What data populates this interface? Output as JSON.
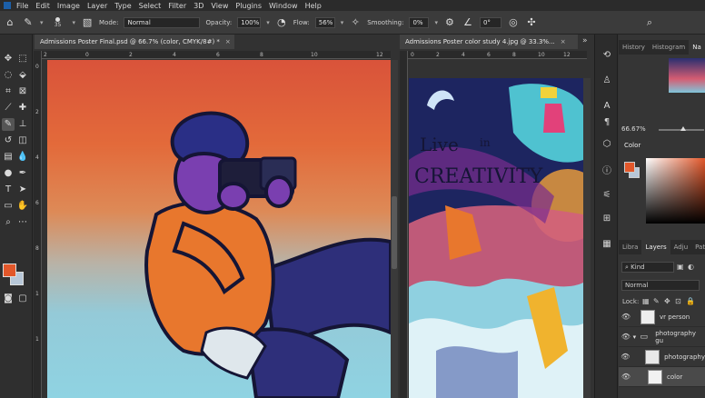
{
  "menu": {
    "items": [
      "File",
      "Edit",
      "Image",
      "Layer",
      "Type",
      "Select",
      "Filter",
      "3D",
      "View",
      "Plugins",
      "Window",
      "Help"
    ]
  },
  "options_bar": {
    "brush_size": "35",
    "mode_label": "Mode:",
    "mode_value": "Normal",
    "opacity_label": "Opacity:",
    "opacity_value": "100%",
    "flow_label": "Flow:",
    "flow_value": "56%",
    "smoothing_label": "Smoothing:",
    "smoothing_value": "0%",
    "angle_value": "0°"
  },
  "documents": {
    "left_tab": "Admissions Poster Final.psd @ 66.7% (color, CMYK/8#) *",
    "right_tab": "Admissions Poster color study 4.jpg @ 33.3%..."
  },
  "rulers": {
    "left_h_ticks": [
      "2",
      "0",
      "2",
      "4",
      "6",
      "8",
      "10",
      "12"
    ],
    "left_v_ticks": [
      "0",
      "2",
      "4",
      "6",
      "8",
      "1",
      "1"
    ],
    "right_h_ticks": [
      "0",
      "2",
      "4",
      "6",
      "8",
      "10",
      "12"
    ]
  },
  "artwork_right": {
    "text_line1": "Live",
    "text_line2": "in",
    "text_line3": "CREATIVITY"
  },
  "panels": {
    "top_tabs": [
      "History",
      "Histogram",
      "Na"
    ],
    "zoom": "66.67%",
    "color_tab": "Color",
    "bottom_tabs": [
      "Libra",
      "Layers",
      "Adju",
      "Path"
    ],
    "kind_filter": "Kind",
    "blend_mode": "Normal",
    "lock_label": "Lock:",
    "layers": [
      {
        "name": "vr person"
      },
      {
        "name": "photography gu"
      },
      {
        "name": "photography"
      },
      {
        "name": "color"
      }
    ]
  },
  "colors": {
    "foreground": "#e2572a",
    "background": "#b7c7d8"
  }
}
